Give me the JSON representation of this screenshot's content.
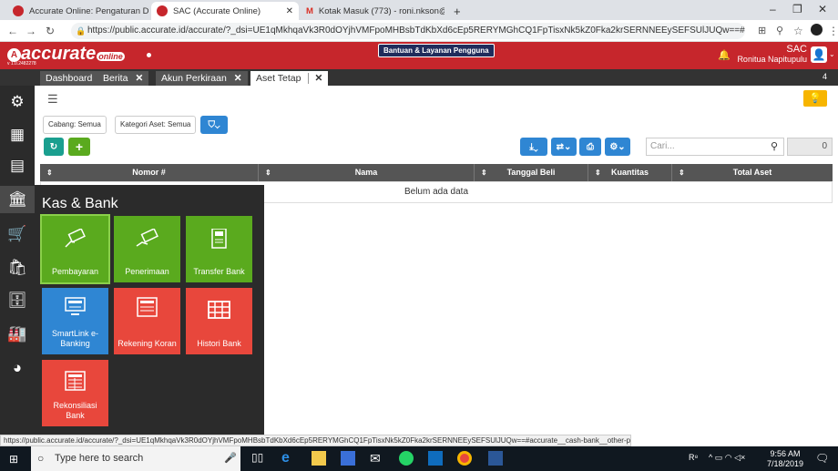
{
  "browser": {
    "tabs": [
      {
        "label": "Accurate Online: Pengaturan Dat",
        "active": false
      },
      {
        "label": "SAC (Accurate Online)",
        "active": true
      },
      {
        "label": "Kotak Masuk (773) - roni.nkson@",
        "active": false
      }
    ],
    "new_tab": "+",
    "url": "https://public.accurate.id/accurate/?_dsi=UE1qMkhqaVk3R0dOYjhVMFpoMHBsbTdKbXd6cEp5RERYMGhCQ1FpTisxNk5kZ0Fka2krSERNNEEySEFSUlJUQw==#"
  },
  "app": {
    "logo": "accurate",
    "logo_sub": "online",
    "version": "v 1.0.2482278",
    "help_button": "Bantuan & Layanan Pengguna",
    "company": "SAC",
    "user": "Ronitua Napitupulu",
    "tab_count": "4"
  },
  "app_tabs": [
    {
      "label": "Dashboard",
      "closable": false
    },
    {
      "label": "Berita",
      "closable": true
    },
    {
      "label": "Akun Perkiraan",
      "closable": true
    },
    {
      "label": "Aset Tetap",
      "closable": true,
      "active": true
    }
  ],
  "filters": {
    "cabang": "Cabang: Semua",
    "kategori": "Kategori Aset: Semua"
  },
  "search": {
    "placeholder": "Cari...",
    "count": "0"
  },
  "table": {
    "columns": [
      "Nomor #",
      "Nama",
      "Tanggal Beli",
      "Kuantitas",
      "Total Aset"
    ],
    "empty": "Belum ada data"
  },
  "menu": {
    "title": "Kas & Bank",
    "items": [
      {
        "label": "Pembayaran",
        "color": "#5aaa1e",
        "icon": "payment-card-icon"
      },
      {
        "label": "Penerimaan",
        "color": "#5aaa1e",
        "icon": "receipt-hand-icon"
      },
      {
        "label": "Transfer Bank",
        "color": "#5aaa1e",
        "icon": "atm-icon"
      },
      {
        "label": "SmartLink e-Banking",
        "color": "#2f86d3",
        "icon": "computer-bank-icon"
      },
      {
        "label": "Rekening Koran",
        "color": "#e8473c",
        "icon": "statement-icon"
      },
      {
        "label": "Histori Bank",
        "color": "#e8473c",
        "icon": "table-icon"
      },
      {
        "label": "Rekonsiliasi Bank",
        "color": "#e8473c",
        "icon": "reconcile-icon"
      }
    ]
  },
  "status_url": "https://public.accurate.id/accurate/?_dsi=UE1qMkhqaVk3R0dOYjhVMFpoMHBsbTdKbXd6cEp5RERYMGhCQ1FpTisxNk5kZ0Fka2krSERNNEEySEFSUlJUQw==#accurate__cash-bank__other-payment",
  "taskbar": {
    "search_placeholder": "Type here to search",
    "time": "9:56 AM",
    "date": "7/18/2019"
  }
}
